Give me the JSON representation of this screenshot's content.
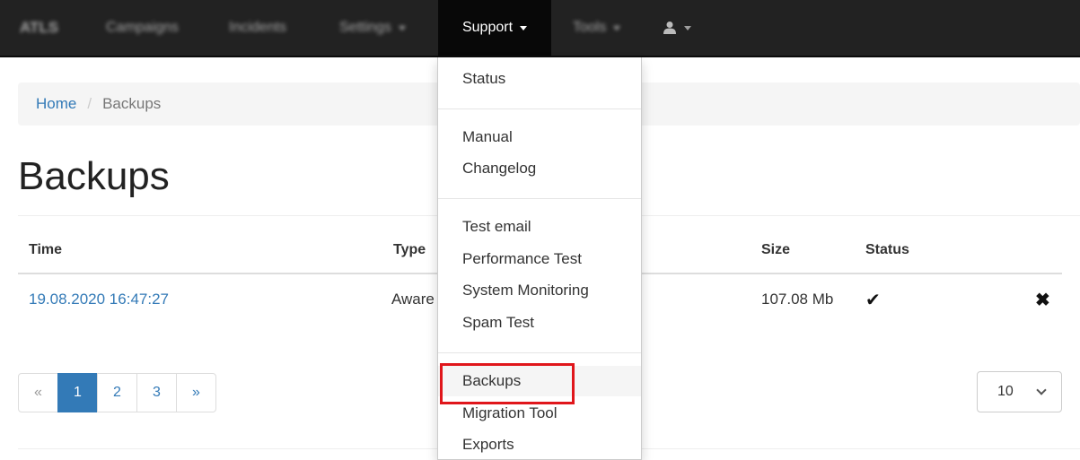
{
  "navbar": {
    "brand": "ATLS",
    "items": [
      "Campaigns",
      "Incidents",
      "Settings",
      "Support",
      "Tools"
    ],
    "user_icon": "user-icon"
  },
  "support_menu": {
    "items": [
      "Status",
      "Manual",
      "Changelog",
      "Test email",
      "Performance Test",
      "System Monitoring",
      "Spam Test",
      "Backups",
      "Migration Tool",
      "Exports"
    ],
    "highlight_color": "#e0161b"
  },
  "breadcrumb": {
    "home": "Home",
    "separator": "/",
    "current": "Backups"
  },
  "page_title": "Backups",
  "table": {
    "headers": {
      "time": "Time",
      "type": "Type",
      "size": "Size",
      "status": "Status"
    },
    "rows": [
      {
        "time": "19.08.2020 16:47:27",
        "type": "Aware",
        "size": "107.08 Mb",
        "status_icon": "check-icon",
        "action_icon": "remove-icon"
      }
    ]
  },
  "pagination": {
    "prev": "«",
    "pages": [
      "1",
      "2",
      "3"
    ],
    "next": "»",
    "active": "1"
  },
  "page_size": {
    "value": "10"
  },
  "colors": {
    "link": "#337ab7",
    "navbar": "#222222",
    "active_page": "#337ab7"
  }
}
